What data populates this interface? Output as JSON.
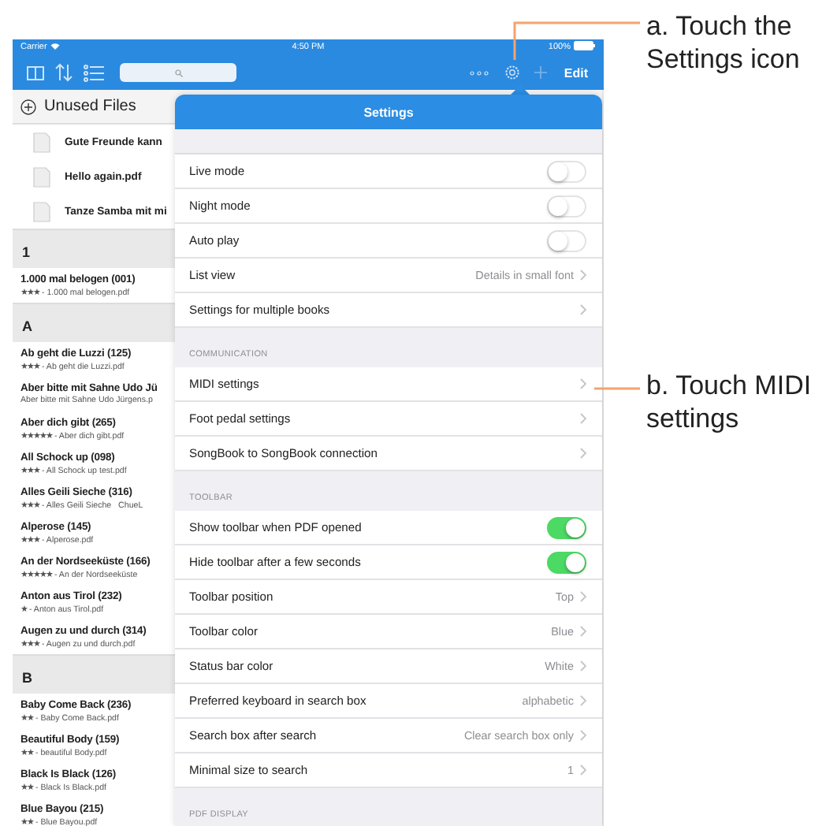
{
  "status_bar": {
    "carrier": "Carrier",
    "time": "4:50 PM",
    "battery": "100%"
  },
  "toolbar": {
    "edit_button": "Edit"
  },
  "unused_files": {
    "title": "Unused Files",
    "files": [
      "Gute Freunde kann",
      "Hello again.pdf",
      "Tanze Samba mit mi"
    ]
  },
  "sections": [
    {
      "letter": "1",
      "items": [
        {
          "title": "1.000 mal belogen (001)",
          "file": "★★★ - 1.000 mal belogen.pdf"
        }
      ]
    },
    {
      "letter": "A",
      "items": [
        {
          "title": "Ab geht die Luzzi (125)",
          "file": "★★★ - Ab geht die Luzzi.pdf"
        },
        {
          "title": "Aber bitte mit Sahne Udo Jü",
          "file": "Aber bitte mit Sahne Udo Jürgens.p"
        },
        {
          "title": "Aber dich gibt (265)",
          "file": "★★★★★ - Aber dich gibt.pdf"
        },
        {
          "title": "All Schock up (098)",
          "file": "★★★ - All Schock up test.pdf"
        },
        {
          "title": "Alles Geili Sieche (316)",
          "file": "★★★ - Alles Geili Sieche   ChueL"
        },
        {
          "title": "Alperose (145)",
          "file": "★★★ - Alperose.pdf"
        },
        {
          "title": "An der Nordseeküste (166)",
          "file": "★★★★★ - An der Nordseeküste"
        },
        {
          "title": "Anton aus Tirol (232)",
          "file": "★ - Anton aus Tirol.pdf"
        },
        {
          "title": "Augen zu und durch (314)",
          "file": "★★★ - Augen zu und durch.pdf"
        }
      ]
    },
    {
      "letter": "B",
      "items": [
        {
          "title": "Baby Come Back (236)",
          "file": "★★ - Baby Come Back.pdf"
        },
        {
          "title": "Beautiful Body (159)",
          "file": "★★ - beautiful Body.pdf"
        },
        {
          "title": "Black Is Black (126)",
          "file": "★★ - Black Is Black.pdf"
        },
        {
          "title": "Blue Bayou (215)",
          "file": "★★ - Blue Bayou.pdf"
        }
      ]
    }
  ],
  "settings": {
    "title": "Settings",
    "groups": [
      {
        "rows": [
          {
            "kind": "switch",
            "label": "Live mode",
            "on": false
          },
          {
            "kind": "switch",
            "label": "Night mode",
            "on": false
          },
          {
            "kind": "switch",
            "label": "Auto play",
            "on": false
          },
          {
            "kind": "detail",
            "label": "List view",
            "value": "Details in small font"
          },
          {
            "kind": "link",
            "label": "Settings for multiple books"
          }
        ]
      },
      {
        "header": "COMMUNICATION",
        "rows": [
          {
            "kind": "link",
            "label": "MIDI settings"
          },
          {
            "kind": "link",
            "label": "Foot pedal settings"
          },
          {
            "kind": "link",
            "label": "SongBook to SongBook connection"
          }
        ]
      },
      {
        "header": "TOOLBAR",
        "rows": [
          {
            "kind": "switch",
            "label": "Show toolbar when PDF opened",
            "on": true
          },
          {
            "kind": "switch",
            "label": "Hide toolbar after a few seconds",
            "on": true
          },
          {
            "kind": "detail",
            "label": "Toolbar position",
            "value": "Top"
          },
          {
            "kind": "detail",
            "label": "Toolbar color",
            "value": "Blue"
          },
          {
            "kind": "detail",
            "label": "Status bar color",
            "value": "White"
          },
          {
            "kind": "detail",
            "label": "Preferred keyboard in search box",
            "value": "alphabetic"
          },
          {
            "kind": "detail",
            "label": "Search box after search",
            "value": "Clear search box only"
          },
          {
            "kind": "detail",
            "label": "Minimal size to search",
            "value": "1"
          }
        ]
      },
      {
        "header": "PDF DISPLAY"
      }
    ]
  },
  "callouts": [
    {
      "text": "a. Touch the Settings icon"
    },
    {
      "text": "b. Touch MIDI settings"
    }
  ]
}
